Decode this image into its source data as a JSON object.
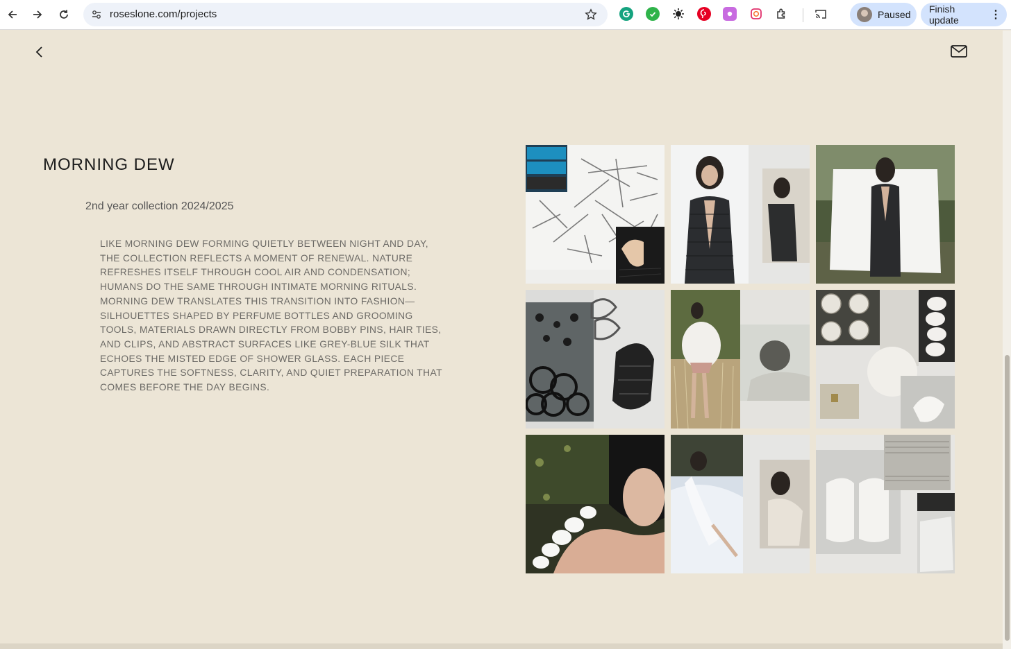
{
  "browser": {
    "url": "roseslone.com/projects",
    "profile_label": "Paused",
    "update_label": "Finish update",
    "extensions": [
      "grammarly-icon",
      "check-icon",
      "sun-icon",
      "pinterest-icon",
      "app-icon",
      "instagram-icon",
      "puzzle-icon"
    ]
  },
  "page": {
    "title": "MORNING DEW",
    "subtitle": "2nd year collection 2024/2025",
    "description": "LIKE MORNING DEW FORMING QUIETLY BETWEEN NIGHT AND DAY, THE COLLECTION REFLECTS A MOMENT OF RENEWAL. NATURE REFRESHES ITSELF THROUGH COOL AIR AND CONDENSATION; HUMANS DO THE SAME THROUGH INTIMATE MORNING RITUALS. MORNING DEW TRANSLATES THIS TRANSITION INTO FASHION—SILHOUETTES SHAPED BY PERFUME BOTTLES AND GROOMING TOOLS, MATERIALS DRAWN DIRECTLY FROM BOBBY PINS, HAIR TIES, AND CLIPS, AND ABSTRACT SURFACES LIKE GREY-BLUE SILK THAT ECHOES THE MISTED EDGE OF SHOWER GLASS. EACH PIECE CAPTURES THE SOFTNESS, CLARITY, AND QUIET PREPARATION THAT COMES BEFORE THE DAY BEGINS."
  },
  "gallery": [
    "bobby-pins-collage",
    "black-dress-front-collage",
    "black-dress-white-backdrop-photo",
    "hair-ties-collage",
    "white-dress-field-collage",
    "white-yarn-collage",
    "model-white-shoulder-piece-photo",
    "model-white-sheets-collage",
    "white-knit-samples-collage"
  ]
}
